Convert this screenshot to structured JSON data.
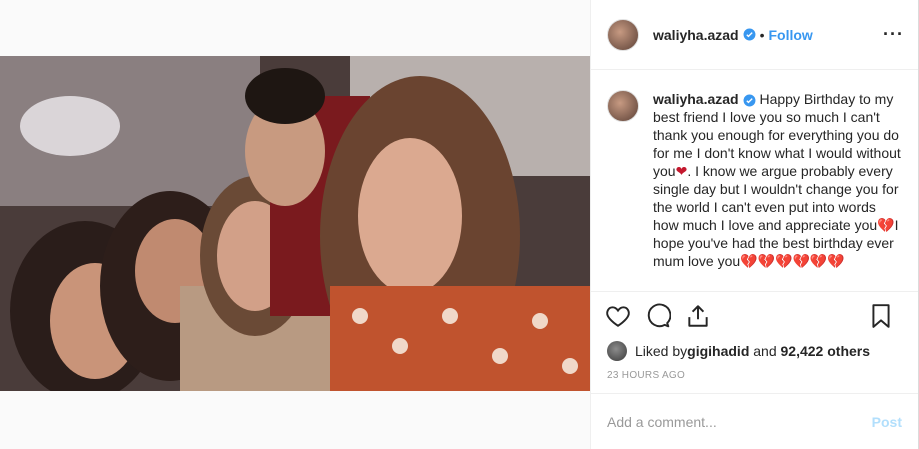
{
  "post": {
    "username": "waliyha.azad",
    "follow_label": "Follow",
    "dot": "•",
    "more_label": "···"
  },
  "caption": {
    "username": "waliyha.azad",
    "part1": " Happy Birthday to my best friend I love you so much I can't thank you enough for everything you do for me I don't know what I would without you",
    "heart1": "❤",
    "part2": ". I know we argue probably every single day but I wouldn't change you for the world I can't even put into words how much I love and appreciate you",
    "heart2": "💔",
    "part3": "I hope you've had the best birthday ever mum love you",
    "hearts_end": "💔💔💔💔💔💔"
  },
  "likes": {
    "prefix": "Liked by ",
    "first_liker": "gigihadid",
    "middle": " and ",
    "count": "92,422 others"
  },
  "timestamp": "23 HOURS AGO",
  "comment": {
    "placeholder": "Add a comment...",
    "post_label": "Post"
  },
  "colors": {
    "accent": "#3897f0",
    "post_disabled": "#b2dffc",
    "heart": "#c4182e"
  },
  "icons": [
    "verified-badge-icon",
    "more-options-icon",
    "heart-icon",
    "comment-icon",
    "share-icon",
    "bookmark-icon"
  ]
}
